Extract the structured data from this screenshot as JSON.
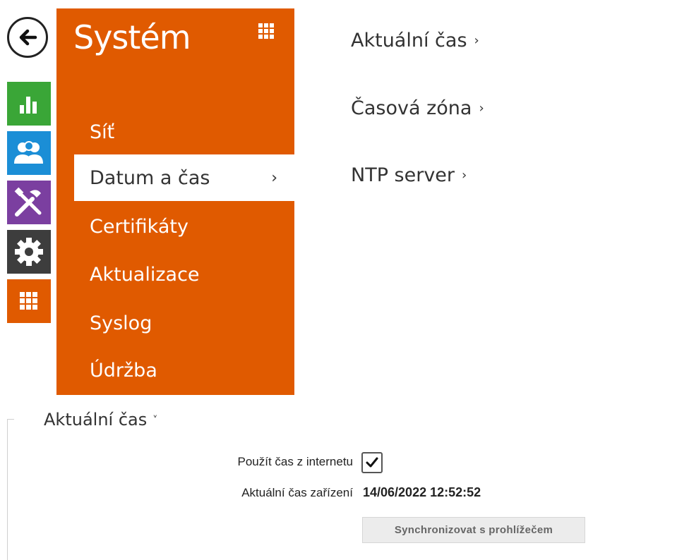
{
  "panel": {
    "title": "Systém",
    "menu": [
      {
        "label": "Síť",
        "active": false
      },
      {
        "label": "Datum a čas",
        "active": true,
        "chevron": "›"
      },
      {
        "label": "Certifikáty",
        "active": false
      },
      {
        "label": "Aktualizace",
        "active": false
      },
      {
        "label": "Syslog",
        "active": false
      },
      {
        "label": "Údržba",
        "active": false
      }
    ]
  },
  "rail": [
    {
      "icon": "status-chart-icon",
      "color": "#3aa637"
    },
    {
      "icon": "users-icon",
      "color": "#1b8ed6"
    },
    {
      "icon": "tools-icon",
      "color": "#7b3fa0"
    },
    {
      "icon": "gear-icon",
      "color": "#3d3d3d"
    },
    {
      "icon": "grid-icon",
      "color": "#e05a00"
    }
  ],
  "sections": [
    {
      "label": "Aktuální čas",
      "chevron": "›"
    },
    {
      "label": "Časová zóna",
      "chevron": "›"
    },
    {
      "label": "NTP server",
      "chevron": "›"
    }
  ],
  "time_group": {
    "heading": "Aktuální čas",
    "chevron": "˅",
    "use_internet_label": "Použít čas z internetu",
    "use_internet_checked": true,
    "device_time_label": "Aktuální čas zařízení",
    "device_time_value": "14/06/2022 12:52:52",
    "sync_button": "Synchronizovat s prohlížečem"
  },
  "colors": {
    "accent": "#e05a00"
  }
}
